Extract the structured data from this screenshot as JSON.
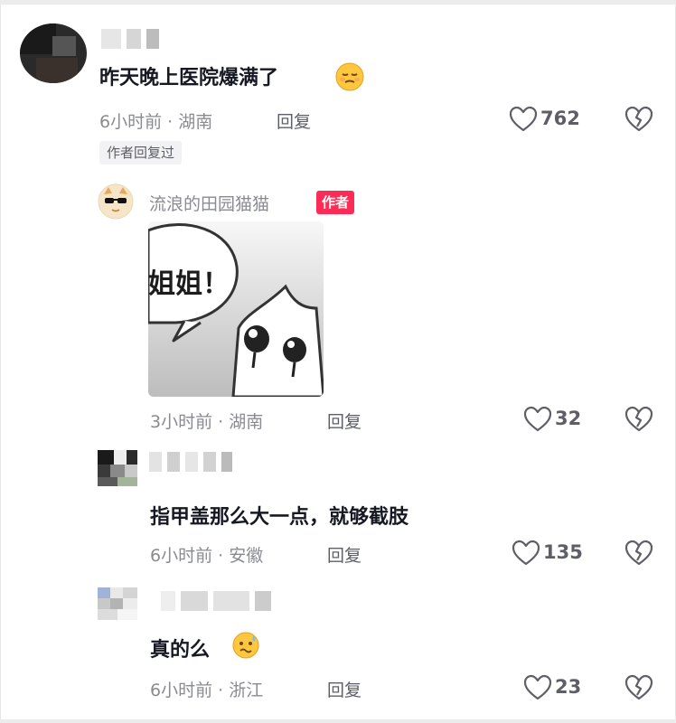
{
  "comments": [
    {
      "text": "昨天晚上医院爆满了",
      "meta": "6小时前 · 湖南",
      "reply": "回复",
      "likes": "762",
      "author_replied": "作者回复过"
    }
  ],
  "author_reply": {
    "name": "流浪的田园猫猫",
    "badge": "作者",
    "sticker_text": "姐姐！",
    "meta": "3小时前 · 湖南",
    "reply": "回复",
    "likes": "32"
  },
  "reply_2": {
    "text": "指甲盖那么大一点，就够截肢",
    "meta": "6小时前 · 安徽",
    "reply": "回复",
    "likes": "135"
  },
  "reply_3": {
    "text": "真的么",
    "meta": "6小时前 · 浙江",
    "reply": "回复",
    "likes": "23"
  },
  "colors": {
    "accent": "#fe2c55",
    "meta": "#8a8b91",
    "text": "#161823"
  },
  "icons": [
    "heart-outline-icon",
    "broken-heart-icon",
    "sleepy-emoji-icon",
    "sweat-emoji-icon"
  ]
}
